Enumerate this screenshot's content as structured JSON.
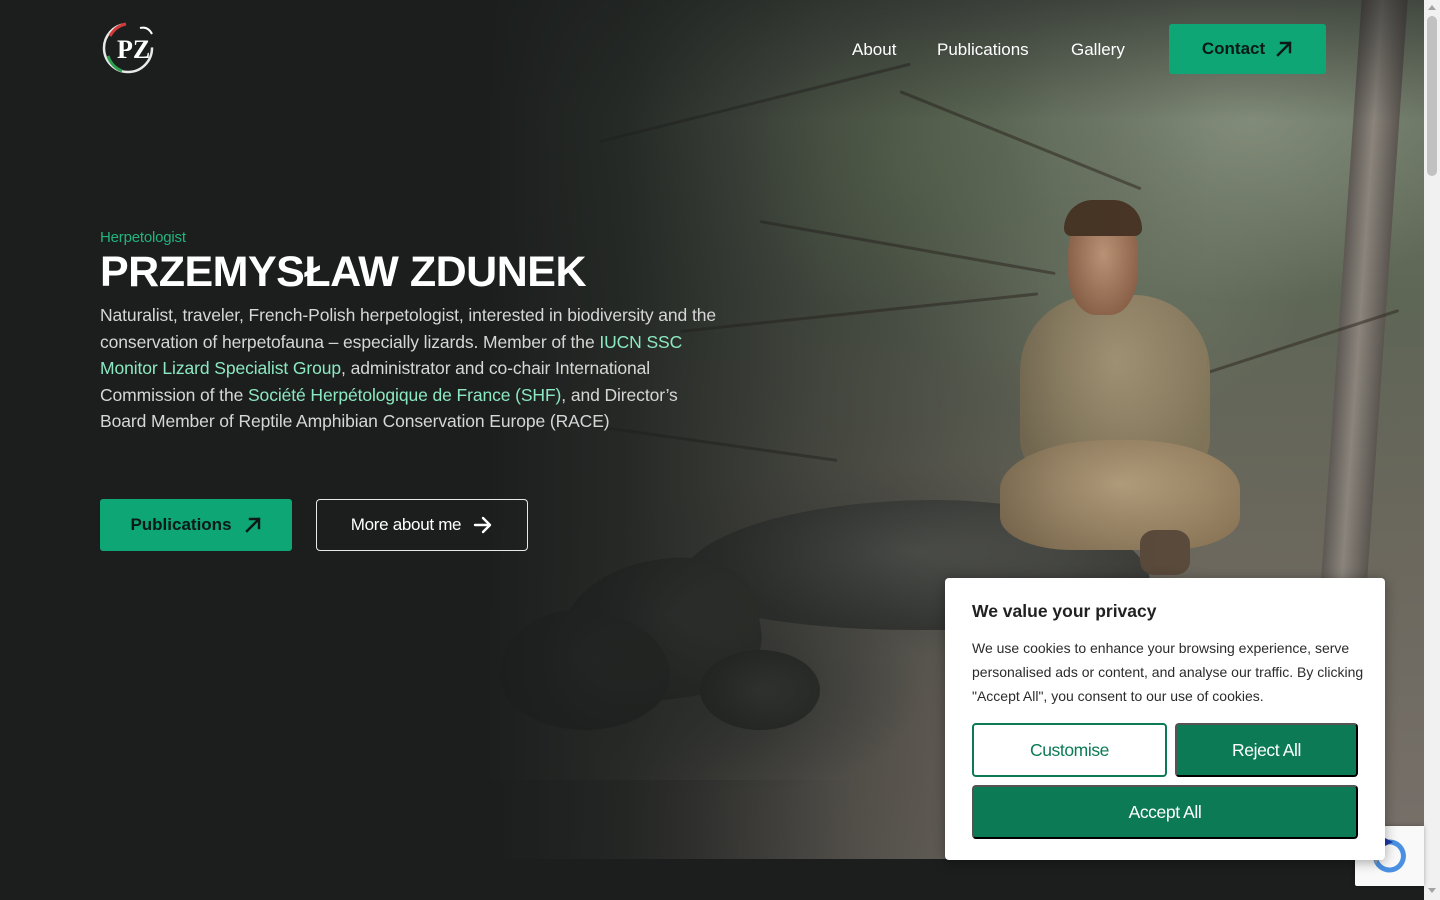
{
  "header": {
    "logo_alt": "PZ",
    "nav": [
      {
        "label": "About"
      },
      {
        "label": "Publications"
      },
      {
        "label": "Gallery"
      }
    ],
    "contact_label": "Contact"
  },
  "hero": {
    "eyebrow": "Herpetologist",
    "title": "PRZEMYSŁAW ZDUNEK",
    "intro_before_iucn": "Naturalist, traveler, French-Polish herpetologist, interested in biodiversity and the conservation of herpetofauna – especially lizards. Member of the ",
    "intro_link_iucn": "IUCN SSC Monitor Lizard Specialist Group",
    "intro_mid": ", administrator and co-chair International Commission of the ",
    "intro_link_shf": "Société Herpétologique de France (SHF)",
    "intro_after": ", and Director’s Board Member of Reptile Amphibian Conservation Europe (RACE)",
    "primary_button": "Publications",
    "secondary_button": "More about me"
  },
  "cookie": {
    "title": "We value your privacy",
    "body": "We use cookies to enhance your browsing experience, serve personalised ads or content, and analyse our traffic. By clicking \"Accept All\", you consent to our use of cookies.",
    "customise": "Customise",
    "reject": "Reject All",
    "accept": "Accept All"
  },
  "colors": {
    "accent": "#0fa676",
    "cookie_accent": "#0c7a55",
    "link_highlight": "#8ce8c1",
    "background": "#1b1e1d"
  },
  "icons": {
    "contact": "arrow-up-right-icon",
    "publications": "arrow-up-right-icon",
    "more": "arrow-right-icon",
    "recaptcha": "recaptcha-icon"
  }
}
